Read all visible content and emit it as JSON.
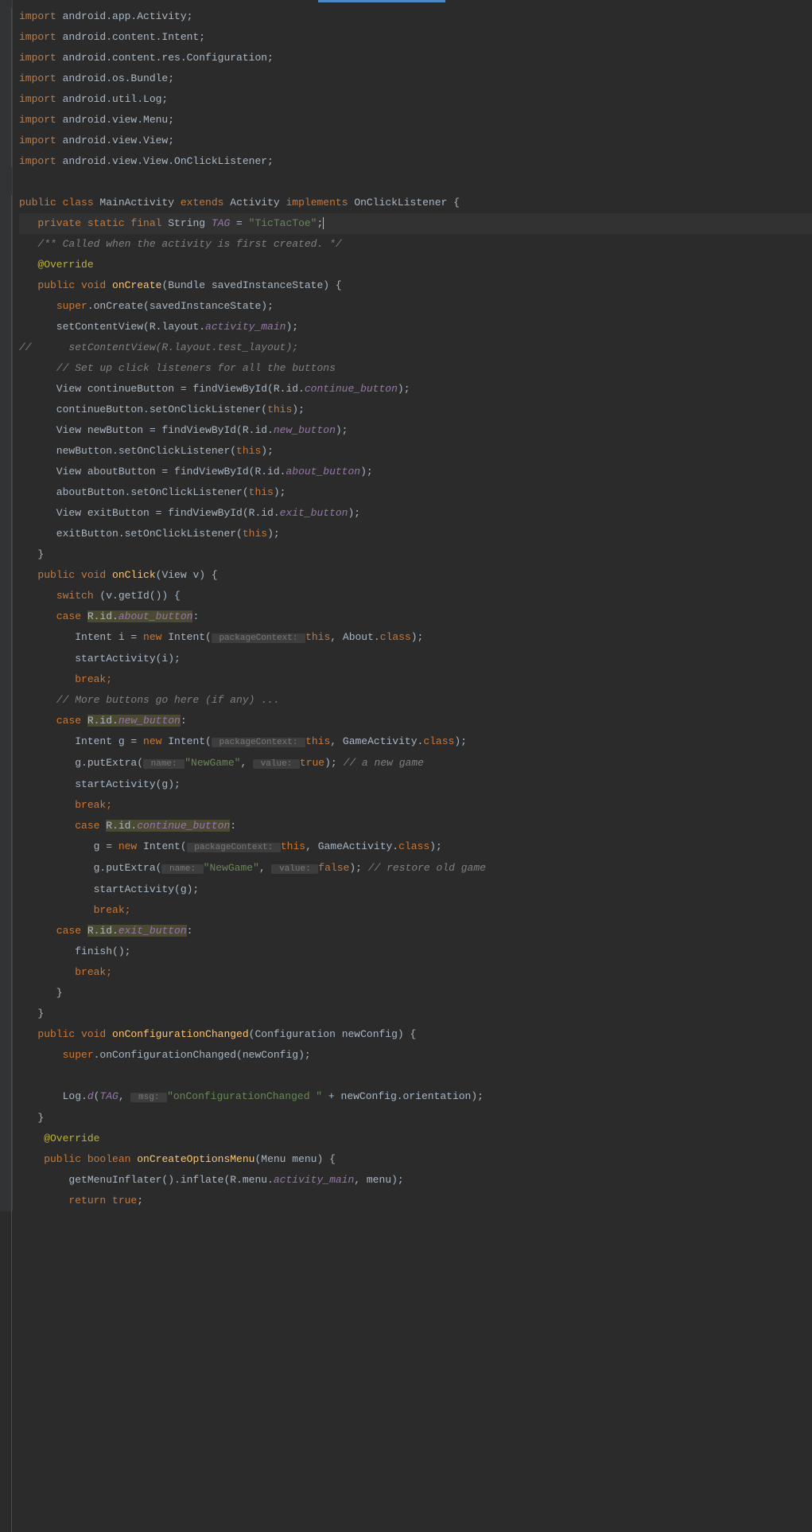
{
  "imports": [
    {
      "p1": "import ",
      "p2": "android.app.Activity;"
    },
    {
      "p1": "import ",
      "p2": "android.content.Intent;"
    },
    {
      "p1": "import ",
      "p2": "android.content.res.Configuration;"
    },
    {
      "p1": "import ",
      "p2": "android.os.Bundle;"
    },
    {
      "p1": "import ",
      "p2": "android.util.Log;"
    },
    {
      "p1": "import ",
      "p2": "android.view.Menu;"
    },
    {
      "p1": "import ",
      "p2": "android.view.View;"
    },
    {
      "p1": "import ",
      "p2": "android.view.View.OnClickListener;"
    }
  ],
  "class_decl": {
    "kw1": "public class ",
    "name": "MainActivity ",
    "kw2": "extends ",
    "sup": "Activity ",
    "kw3": "implements ",
    "iface": "OnClickListener {"
  },
  "tag_line": {
    "kw": "   private static final ",
    "type": "String ",
    "var": "TAG",
    "eq": " = ",
    "val": "\"TicTacToe\"",
    "end": ";"
  },
  "doc": "   /** Called when the activity is first created. */",
  "override": "   @Override",
  "oncreate_sig": {
    "kw": "   public void ",
    "fn": "onCreate",
    "args": "(Bundle savedInstanceState) {"
  },
  "super_oncreate": {
    "pre": "      ",
    "kw": "super",
    "call": ".onCreate(savedInstanceState);"
  },
  "setcontent": {
    "pre": "      setContentView(R.layout.",
    "fld": "activity_main",
    "post": ");"
  },
  "commented_setcontent": "//      setContentView(R.layout.test_layout);",
  "click_comment": "      // Set up click listeners for all the buttons",
  "btn_continue_find": {
    "pre": "      View continueButton = findViewById(R.id.",
    "fld": "continue_button",
    "post": ");"
  },
  "btn_continue_set": {
    "pre": "      continueButton.setOnClickListener(",
    "kw": "this",
    "post": ");"
  },
  "btn_new_find": {
    "pre": "      View newButton = findViewById(R.id.",
    "fld": "new_button",
    "post": ");"
  },
  "btn_new_set": {
    "pre": "      newButton.setOnClickListener(",
    "kw": "this",
    "post": ");"
  },
  "btn_about_find": {
    "pre": "      View aboutButton = findViewById(R.id.",
    "fld": "about_button",
    "post": ");"
  },
  "btn_about_set": {
    "pre": "      aboutButton.setOnClickListener(",
    "kw": "this",
    "post": ");"
  },
  "btn_exit_find": {
    "pre": "      View exitButton = findViewById(R.id.",
    "fld": "exit_button",
    "post": ");"
  },
  "btn_exit_set": {
    "pre": "      exitButton.setOnClickListener(",
    "kw": "this",
    "post": ");"
  },
  "close_method": "   }",
  "onclick_sig": {
    "kw": "   public void ",
    "fn": "onClick",
    "args": "(View v) {"
  },
  "switch_open": {
    "pre": "      ",
    "kw": "switch ",
    "post": "(v.getId()) {"
  },
  "case_about": {
    "kw": "      case ",
    "ref": "R.id.",
    "fld": "about_button",
    "post": ":"
  },
  "intent_i": {
    "pre": "         Intent i = ",
    "kw": "new ",
    "cls": "Intent(",
    "hint": " packageContext: ",
    "kw2": "this",
    "post": ", About.",
    "kw3": "class",
    "end": ");"
  },
  "start_i": "         startActivity(i);",
  "break1": {
    "pre": "         ",
    "kw": "break;"
  },
  "more_comment": "      // More buttons go here (if any) ...",
  "case_new": {
    "kw": "      case ",
    "ref": "R.id.",
    "fld": "new_button",
    "post": ":"
  },
  "intent_g": {
    "pre": "         Intent g = ",
    "kw": "new ",
    "cls": "Intent(",
    "hint": " packageContext: ",
    "kw2": "this",
    "post": ", GameActivity.",
    "kw3": "class",
    "end": ");"
  },
  "putextra_new": {
    "pre": "         g.putExtra(",
    "h1": " name: ",
    "s1": "\"NewGame\"",
    "mid": ", ",
    "h2": " value: ",
    "kw": "true",
    "post": "); ",
    "com": "// a new game"
  },
  "start_g": "         startActivity(g);",
  "break2": {
    "pre": "         ",
    "kw": "break;"
  },
  "case_continue": {
    "kw": "         case ",
    "ref": "R.id.",
    "fld": "continue_button",
    "post": ":"
  },
  "intent_g2": {
    "pre": "            g = ",
    "kw": "new ",
    "cls": "Intent(",
    "hint": " packageContext: ",
    "kw2": "this",
    "post": ", GameActivity.",
    "kw3": "class",
    "end": ");"
  },
  "putextra_cont": {
    "pre": "            g.putExtra(",
    "h1": " name: ",
    "s1": "\"NewGame\"",
    "mid": ", ",
    "h2": " value: ",
    "kw": "false",
    "post": "); ",
    "com": "// restore old game"
  },
  "start_g2": "            startActivity(g);",
  "break3": {
    "pre": "            ",
    "kw": "break;"
  },
  "case_exit": {
    "kw": "      case ",
    "ref": "R.id.",
    "fld": "exit_button",
    "post": ":"
  },
  "finish": "         finish();",
  "break4": {
    "pre": "         ",
    "kw": "break;"
  },
  "close_switch": "      }",
  "close_onclick": "   }",
  "onconfig_sig": {
    "kw": "   public void ",
    "fn": "onConfigurationChanged",
    "args": "(Configuration newConfig) {"
  },
  "super_onconfig": {
    "pre": "       ",
    "kw": "super",
    "call": ".onConfigurationChanged(newConfig);"
  },
  "log_d": {
    "pre": "       Log.",
    "fn": "d",
    "open": "(",
    "var": "TAG",
    "mid": ", ",
    "hint": " msg: ",
    "s": "\"onConfigurationChanged \"",
    "plus": " + newConfig.orientation);"
  },
  "close_onconfig": "   }",
  "override2": "    @Override",
  "onmenu_sig": {
    "kw": "    public boolean ",
    "fn": "onCreateOptionsMenu",
    "args": "(Menu menu) {"
  },
  "inflate": {
    "pre": "        getMenuInflater().inflate(R.menu.",
    "fld": "activity_main",
    "post": ", menu);"
  },
  "return_true": {
    "pre": "        ",
    "kw": "return true",
    ";": ";"
  }
}
